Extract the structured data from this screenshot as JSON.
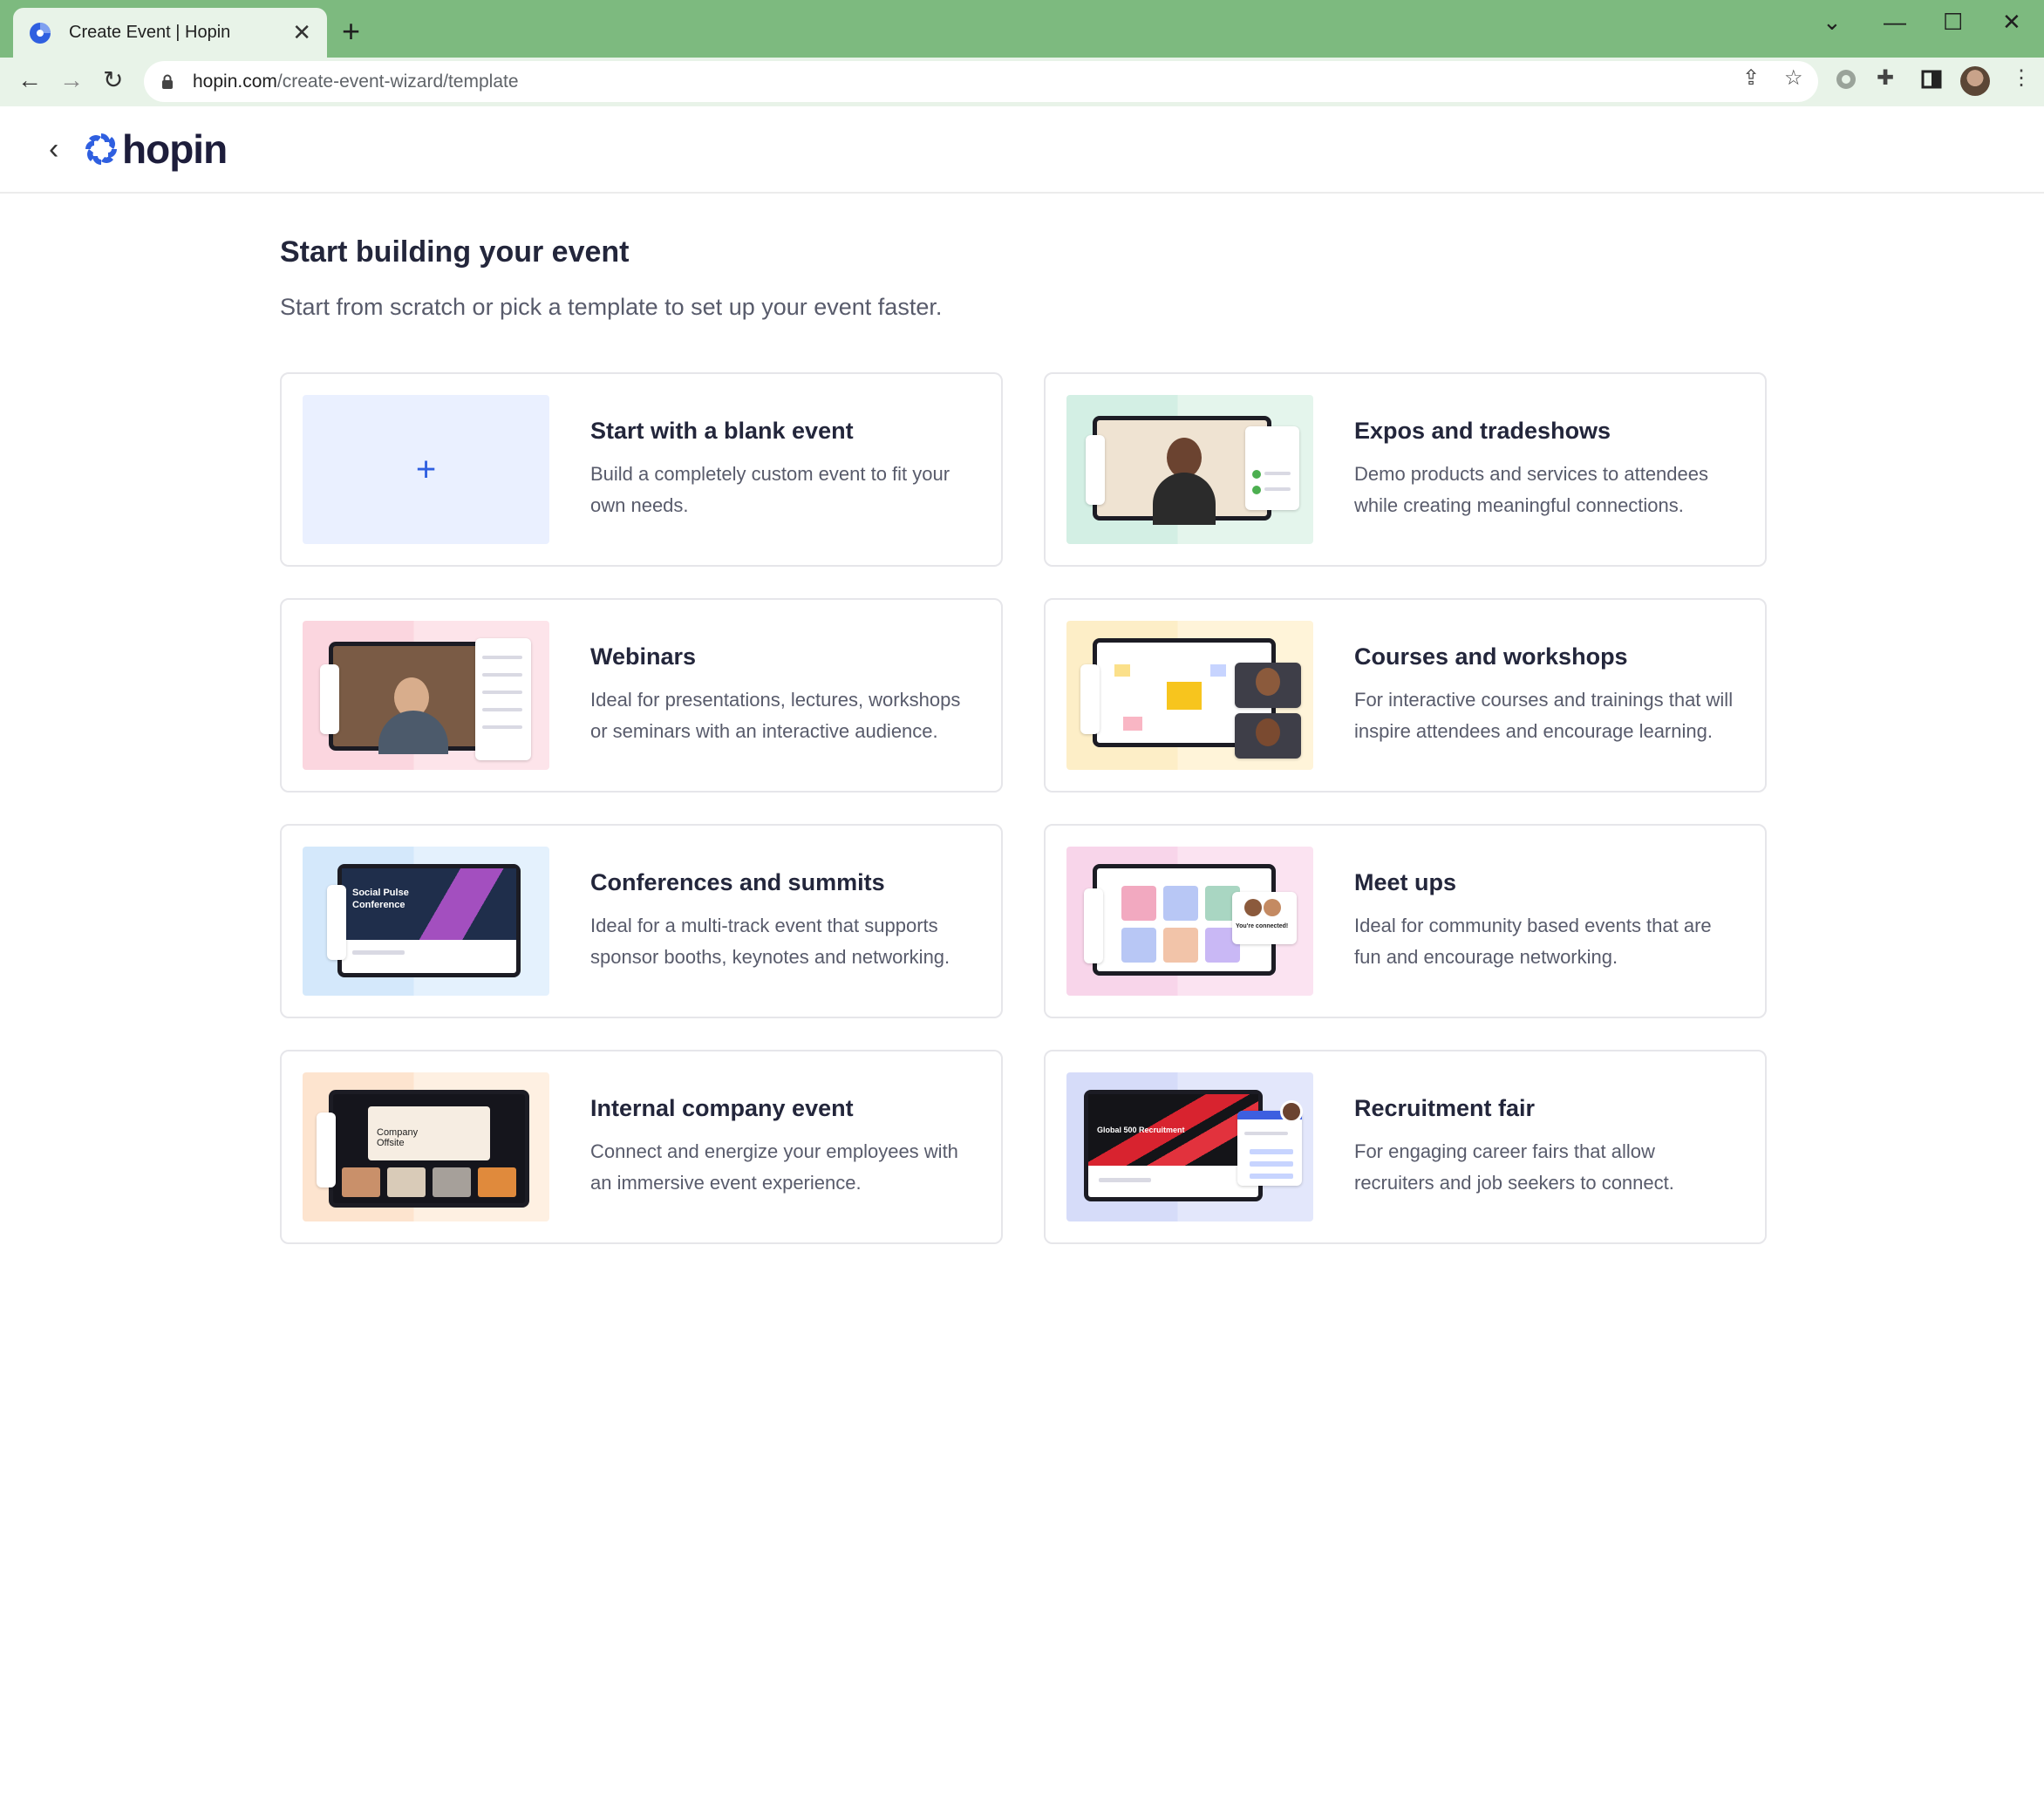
{
  "browser": {
    "tab_title": "Create Event | Hopin",
    "new_tab_symbol": "+",
    "url_host": "hopin.com",
    "url_path": "/create-event-wizard/template"
  },
  "app": {
    "logo_text": "hopin",
    "title": "Start building your event",
    "subtitle": "Start from scratch or pick a template to set up your event faster."
  },
  "templates": [
    {
      "title": "Start with a blank event",
      "desc_l1": "Build a completely custom event to fit your",
      "desc_l2": "own needs.",
      "icon": "plus-icon"
    },
    {
      "title": "Expos and tradeshows",
      "desc_l1": "Demo products and services to attendees",
      "desc_l2": "while creating meaningful connections."
    },
    {
      "title": "Webinars",
      "desc_l1": "Ideal for presentations, lectures, workshops",
      "desc_l2": "or seminars with an interactive audience."
    },
    {
      "title": "Courses and workshops",
      "desc_l1": "For interactive courses and trainings that will",
      "desc_l2": "inspire attendees and encourage learning."
    },
    {
      "title": "Conferences and summits",
      "desc_l1": "Ideal for a multi-track event that supports",
      "desc_l2": "sponsor booths, keynotes and networking.",
      "thumb_l1": "Social Pulse",
      "thumb_l2": "Conference"
    },
    {
      "title": "Meet ups",
      "desc_l1": "Ideal for community based events that are",
      "desc_l2": "fun and encourage networking.",
      "thumb_text": "You're connected!"
    },
    {
      "title": "Internal company event",
      "desc_l1": "Connect and energize your employees with",
      "desc_l2": "an immersive event experience.",
      "thumb_l1": "Company",
      "thumb_l2": "Offsite"
    },
    {
      "title": "Recruitment fair",
      "desc_l1": "For engaging career fairs that allow",
      "desc_l2": "recruiters and job seekers to connect.",
      "thumb_text": "Global 500 Recruitment"
    }
  ],
  "colors": {
    "tabbar": "#7dba7f",
    "accent": "#2f5fe0",
    "title": "#23263b"
  }
}
